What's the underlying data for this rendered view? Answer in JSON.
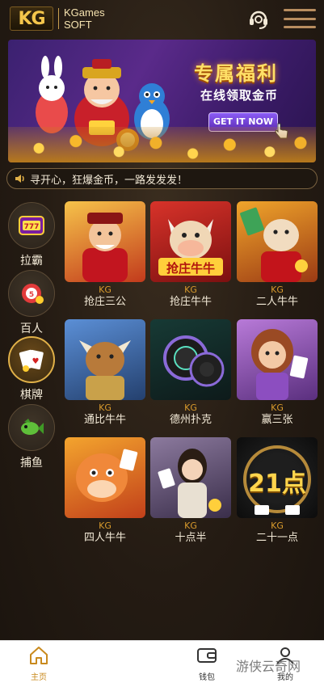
{
  "header": {
    "logo_mark": "KG",
    "logo_line1": "KGames",
    "logo_line2": "SOFT"
  },
  "banner": {
    "title": "专属福利",
    "subtitle": "在线领取金币",
    "cta": "GET IT NOW"
  },
  "marquee": {
    "text": "寻开心，狂爆金币，一路发发发！"
  },
  "categories": [
    {
      "label": "拉霸",
      "icon": "slot-machine-icon",
      "active": false
    },
    {
      "label": "百人",
      "icon": "lottery-ball-icon",
      "active": false
    },
    {
      "label": "棋牌",
      "icon": "playing-cards-icon",
      "active": true
    },
    {
      "label": "捕鱼",
      "icon": "fish-icon",
      "active": false
    }
  ],
  "games": [
    {
      "brand": "KG",
      "name": "抢庄三公",
      "thumb_label": ""
    },
    {
      "brand": "KG",
      "name": "抢庄牛牛",
      "thumb_label": "抢庄牛牛"
    },
    {
      "brand": "KG",
      "name": "二人牛牛",
      "thumb_label": ""
    },
    {
      "brand": "KG",
      "name": "通比牛牛",
      "thumb_label": ""
    },
    {
      "brand": "KG",
      "name": "德州扑克",
      "thumb_label": ""
    },
    {
      "brand": "KG",
      "name": "赢三张",
      "thumb_label": ""
    },
    {
      "brand": "KG",
      "name": "四人牛牛",
      "thumb_label": ""
    },
    {
      "brand": "KG",
      "name": "十点半",
      "thumb_label": ""
    },
    {
      "brand": "KG",
      "name": "二十一点",
      "thumb_label": "21点"
    }
  ],
  "bottom_nav": [
    {
      "label": "主页",
      "icon": "home-icon",
      "active": true
    },
    {
      "label": "钱包",
      "icon": "wallet-icon",
      "active": false
    },
    {
      "label": "我的",
      "icon": "user-icon",
      "active": false
    }
  ],
  "watermark": "游侠云奇网",
  "colors": {
    "accent_gold": "#e0b048",
    "brand_orange": "#d89a2c",
    "background": "#241b13",
    "nav_active": "#c98a1e"
  }
}
